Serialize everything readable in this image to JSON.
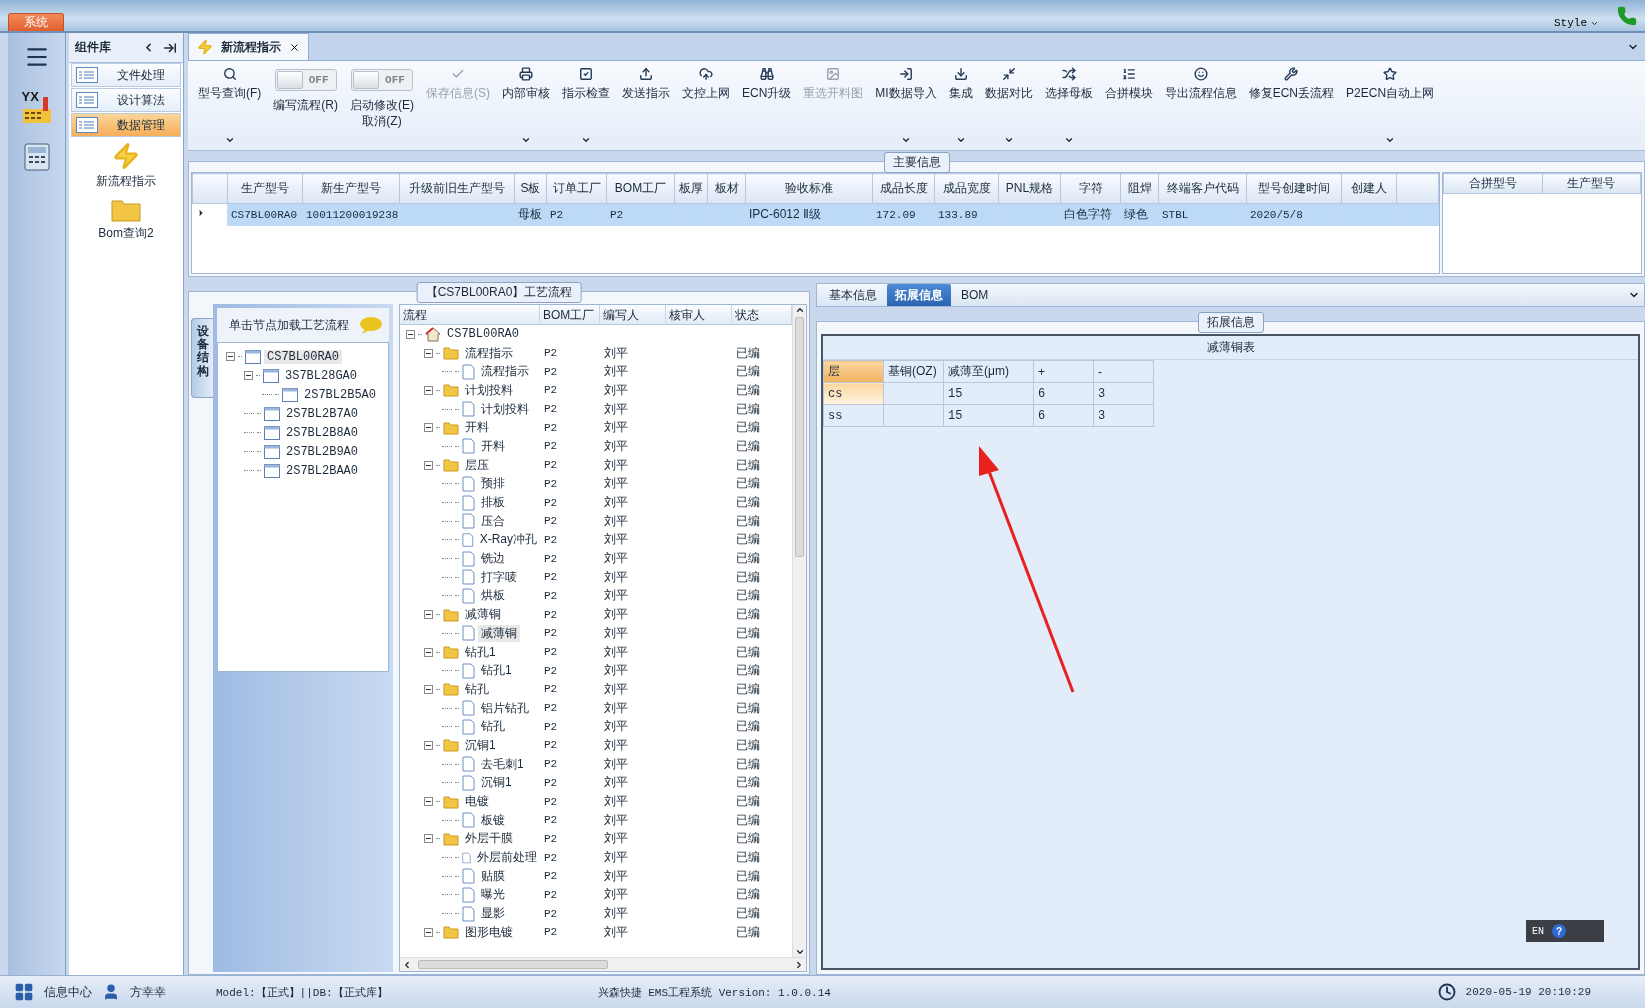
{
  "title_bar": {
    "menu_tab": "系统",
    "style_label": "Style"
  },
  "rail": {
    "logo_text": "YX"
  },
  "sidebar": {
    "title": "组件库",
    "items": [
      {
        "label": "文件处理",
        "selected": false
      },
      {
        "label": "设计算法",
        "selected": false
      },
      {
        "label": "数据管理",
        "selected": true
      }
    ],
    "launchers": [
      {
        "label": "新流程指示"
      },
      {
        "label": "Bom查询2"
      }
    ]
  },
  "document_tab": {
    "title": "新流程指示"
  },
  "toolbar": [
    {
      "kind": "button",
      "label": "型号查询(F)",
      "dropdown": true,
      "disabled": false
    },
    {
      "kind": "toggle",
      "label": "编写流程(R)",
      "state_text": "OFF",
      "on": false
    },
    {
      "kind": "toggle",
      "label": "启动修改(E)\n取消(Z)",
      "state_text": "OFF",
      "on": false
    },
    {
      "kind": "button",
      "label": "保存信息(S)",
      "dropdown": false,
      "disabled": true
    },
    {
      "kind": "button",
      "label": "内部审核",
      "dropdown": true,
      "disabled": false
    },
    {
      "kind": "button",
      "label": "指示检查",
      "dropdown": true,
      "disabled": false
    },
    {
      "kind": "button",
      "label": "发送指示",
      "dropdown": false,
      "disabled": false
    },
    {
      "kind": "button",
      "label": "文控上网",
      "dropdown": false,
      "disabled": false
    },
    {
      "kind": "button",
      "label": "ECN升级",
      "dropdown": false,
      "disabled": false
    },
    {
      "kind": "button",
      "label": "重选开料图",
      "dropdown": false,
      "disabled": true
    },
    {
      "kind": "button",
      "label": "MI数据导入",
      "dropdown": true,
      "disabled": false
    },
    {
      "kind": "button",
      "label": "集成",
      "dropdown": true,
      "disabled": false
    },
    {
      "kind": "button",
      "label": "数据对比",
      "dropdown": true,
      "disabled": false
    },
    {
      "kind": "button",
      "label": "选择母板",
      "dropdown": true,
      "disabled": false
    },
    {
      "kind": "button",
      "label": "合拼模块",
      "dropdown": false,
      "disabled": false
    },
    {
      "kind": "button",
      "label": "导出流程信息",
      "dropdown": false,
      "disabled": false
    },
    {
      "kind": "button",
      "label": "修复ECN丢流程",
      "dropdown": false,
      "disabled": false
    },
    {
      "kind": "button",
      "label": "P2ECN自动上网",
      "dropdown": true,
      "disabled": false
    }
  ],
  "main_info": {
    "title": "主要信息",
    "columns": [
      "生产型号",
      "新生产型号",
      "升级前旧生产型号",
      "S板",
      "订单工厂",
      "BOM工厂",
      "板厚",
      "板材",
      "验收标准",
      "成品长度",
      "成品宽度",
      "PNL规格",
      "字符",
      "阻焊",
      "终端客户代码",
      "型号创建时间",
      "创建人"
    ],
    "rows": [
      {
        "selected": true,
        "cells": [
          "CS7BL00RA0",
          "10011200019238",
          null,
          "母板",
          "P2",
          "P2",
          null,
          null,
          "IPC-6012 Ⅱ级",
          "172.09",
          "133.89",
          null,
          "白色字符",
          "绿色",
          "STBL",
          "2020/5/8",
          null
        ]
      }
    ],
    "side_columns": [
      "合拼型号",
      "生产型号"
    ]
  },
  "process_panel": {
    "title": "【CS7BL00RA0】工艺流程",
    "side_tab": "设备结构",
    "device_header": "单击节点加载工艺流程",
    "device_tree": [
      {
        "label": "CS7BL00RA0",
        "selected": true,
        "expanded": true,
        "children": [
          {
            "label": "3S7BL28GA0",
            "selected": false,
            "expanded": true,
            "children": [
              {
                "label": "2S7BL2B5A0",
                "selected": false
              }
            ]
          },
          {
            "label": "2S7BL2B7A0",
            "selected": false
          },
          {
            "label": "2S7BL2B8A0",
            "selected": false
          },
          {
            "label": "2S7BL2B9A0",
            "selected": false
          },
          {
            "label": "2S7BL2BAA0",
            "selected": false
          }
        ]
      }
    ],
    "columns": [
      "流程",
      "BOM工厂",
      "编写人",
      "核审人",
      "状态"
    ],
    "tree": [
      {
        "label": "CS7BL00RA0",
        "kind": "root",
        "expanded": true,
        "selected": false,
        "children": [
          {
            "label": "流程指示",
            "kind": "folder",
            "bom": "P2",
            "writer": "刘平",
            "status": "已编",
            "expanded": true,
            "selected": false,
            "children": [
              {
                "label": "流程指示",
                "kind": "file",
                "bom": "P2",
                "writer": "刘平",
                "status": "已编",
                "selected": false
              }
            ]
          },
          {
            "label": "计划投料",
            "kind": "folder",
            "bom": "P2",
            "writer": "刘平",
            "status": "已编",
            "expanded": true,
            "selected": false,
            "children": [
              {
                "label": "计划投料",
                "kind": "file",
                "bom": "P2",
                "writer": "刘平",
                "status": "已编",
                "selected": false
              }
            ]
          },
          {
            "label": "开料",
            "kind": "folder",
            "bom": "P2",
            "writer": "刘平",
            "status": "已编",
            "expanded": true,
            "selected": false,
            "children": [
              {
                "label": "开料",
                "kind": "file",
                "bom": "P2",
                "writer": "刘平",
                "status": "已编",
                "selected": false
              }
            ]
          },
          {
            "label": "层压",
            "kind": "folder",
            "bom": "P2",
            "writer": "刘平",
            "status": "已编",
            "expanded": true,
            "selected": false,
            "children": [
              {
                "label": "预排",
                "kind": "file",
                "bom": "P2",
                "writer": "刘平",
                "status": "已编",
                "selected": false
              },
              {
                "label": "排板",
                "kind": "file",
                "bom": "P2",
                "writer": "刘平",
                "status": "已编",
                "selected": false
              },
              {
                "label": "压合",
                "kind": "file",
                "bom": "P2",
                "writer": "刘平",
                "status": "已编",
                "selected": false
              },
              {
                "label": "X-Ray冲孔",
                "kind": "file",
                "bom": "P2",
                "writer": "刘平",
                "status": "已编",
                "selected": false
              },
              {
                "label": "铣边",
                "kind": "file",
                "bom": "P2",
                "writer": "刘平",
                "status": "已编",
                "selected": false
              },
              {
                "label": "打字唛",
                "kind": "file",
                "bom": "P2",
                "writer": "刘平",
                "status": "已编",
                "selected": false
              },
              {
                "label": "烘板",
                "kind": "file",
                "bom": "P2",
                "writer": "刘平",
                "status": "已编",
                "selected": false
              }
            ]
          },
          {
            "label": "减薄铜",
            "kind": "folder",
            "bom": "P2",
            "writer": "刘平",
            "status": "已编",
            "expanded": true,
            "selected": false,
            "children": [
              {
                "label": "减薄铜",
                "kind": "file",
                "bom": "P2",
                "writer": "刘平",
                "status": "已编",
                "selected": true
              }
            ]
          },
          {
            "label": "钻孔1",
            "kind": "folder",
            "bom": "P2",
            "writer": "刘平",
            "status": "已编",
            "expanded": true,
            "selected": false,
            "children": [
              {
                "label": "钻孔1",
                "kind": "file",
                "bom": "P2",
                "writer": "刘平",
                "status": "已编",
                "selected": false
              }
            ]
          },
          {
            "label": "钻孔",
            "kind": "folder",
            "bom": "P2",
            "writer": "刘平",
            "status": "已编",
            "expanded": true,
            "selected": false,
            "children": [
              {
                "label": "铝片钻孔",
                "kind": "file",
                "bom": "P2",
                "writer": "刘平",
                "status": "已编",
                "selected": false
              },
              {
                "label": "钻孔",
                "kind": "file",
                "bom": "P2",
                "writer": "刘平",
                "status": "已编",
                "selected": false
              }
            ]
          },
          {
            "label": "沉铜1",
            "kind": "folder",
            "bom": "P2",
            "writer": "刘平",
            "status": "已编",
            "expanded": true,
            "selected": false,
            "children": [
              {
                "label": "去毛刺1",
                "kind": "file",
                "bom": "P2",
                "writer": "刘平",
                "status": "已编",
                "selected": false
              },
              {
                "label": "沉铜1",
                "kind": "file",
                "bom": "P2",
                "writer": "刘平",
                "status": "已编",
                "selected": false
              }
            ]
          },
          {
            "label": "电镀",
            "kind": "folder",
            "bom": "P2",
            "writer": "刘平",
            "status": "已编",
            "expanded": true,
            "selected": false,
            "children": [
              {
                "label": "板镀",
                "kind": "file",
                "bom": "P2",
                "writer": "刘平",
                "status": "已编",
                "selected": false
              }
            ]
          },
          {
            "label": "外层干膜",
            "kind": "folder",
            "bom": "P2",
            "writer": "刘平",
            "status": "已编",
            "expanded": true,
            "selected": false,
            "children": [
              {
                "label": "外层前处理",
                "kind": "file",
                "bom": "P2",
                "writer": "刘平",
                "status": "已编",
                "selected": false
              },
              {
                "label": "贴膜",
                "kind": "file",
                "bom": "P2",
                "writer": "刘平",
                "status": "已编",
                "selected": false
              },
              {
                "label": "曝光",
                "kind": "file",
                "bom": "P2",
                "writer": "刘平",
                "status": "已编",
                "selected": false
              },
              {
                "label": "显影",
                "kind": "file",
                "bom": "P2",
                "writer": "刘平",
                "status": "已编",
                "selected": false
              }
            ]
          },
          {
            "label": "图形电镀",
            "kind": "folder",
            "bom": "P2",
            "writer": "刘平",
            "status": "已编",
            "expanded": true,
            "selected": false
          }
        ]
      }
    ]
  },
  "detail_panel": {
    "tabs": [
      {
        "label": "基本信息",
        "selected": false
      },
      {
        "label": "拓展信息",
        "selected": true
      },
      {
        "label": "BOM",
        "selected": false
      }
    ],
    "group_title": "拓展信息",
    "table_title": "减薄铜表",
    "columns": [
      "层",
      "基铜(OZ)",
      "减薄至(μm)",
      "+",
      "-"
    ],
    "rows": [
      {
        "selected": true,
        "cells": [
          "cs",
          null,
          "15",
          "6",
          "3"
        ]
      },
      {
        "selected": false,
        "cells": [
          "ss",
          null,
          "15",
          "6",
          "3"
        ]
      }
    ]
  },
  "ime_bar": {
    "label": "EN",
    "help": "?"
  },
  "status_bar": {
    "info_center": "信息中心",
    "user": "方幸幸",
    "model": "Model:【正式】||DB:【正式库】",
    "app": "兴森快捷 EMS工程系统 Version: 1.0.0.14",
    "time": "2020-05-19 20:10:29"
  }
}
